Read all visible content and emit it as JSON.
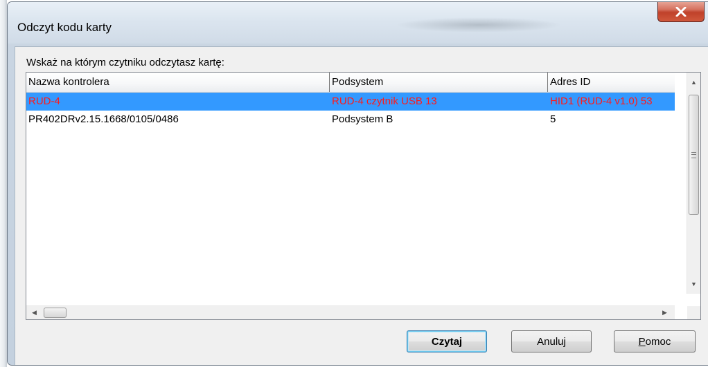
{
  "window": {
    "title": "Odczyt kodu karty",
    "close_glyph": "X"
  },
  "prompt": "Wskaż na którym czytniku odczytasz kartę:",
  "listview": {
    "columns": [
      "Nazwa kontrolera",
      "Podsystem",
      "Adres ID"
    ],
    "rows": [
      {
        "name": "RUD-4",
        "subsystem": "RUD-4 czytnik USB 13",
        "address": "HID1 (RUD-4 v1.0) 53",
        "selected": true
      },
      {
        "name": "PR402DRv2.15.1668/0105/0486",
        "subsystem": "Podsystem B",
        "address": "5",
        "selected": false
      }
    ]
  },
  "buttons": {
    "read": "Czytaj",
    "cancel": "Anuluj",
    "help_mnemonic": "P",
    "help_rest": "omoc"
  },
  "colors": {
    "selection_bg": "#3399ff",
    "selection_text": "#ff1a1a",
    "close_button": "#c0412a"
  }
}
